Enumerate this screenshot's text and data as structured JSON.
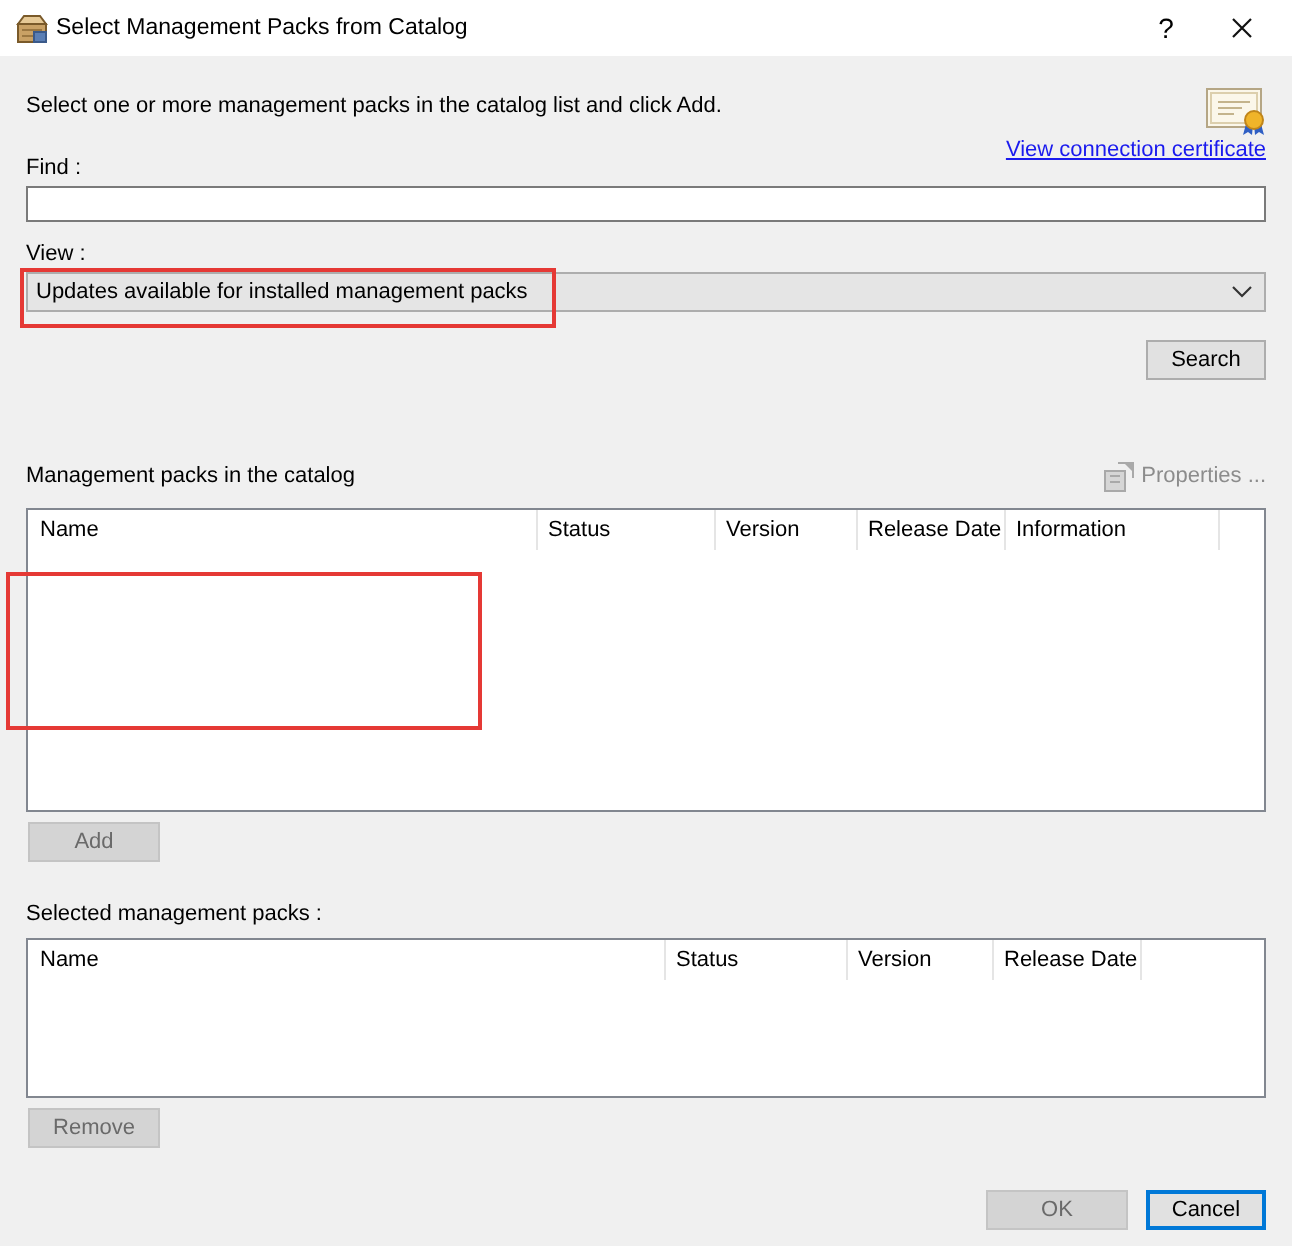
{
  "window": {
    "title": "Select Management Packs from Catalog",
    "help": "?"
  },
  "instructions": "Select one or more management packs in the catalog list and click Add.",
  "certificate_link": "View connection certificate",
  "find": {
    "label": "Find :"
  },
  "view": {
    "label": "View :",
    "value": "Updates available for installed management packs",
    "highlighted": true
  },
  "search_button": {
    "label": "Search",
    "disabled": false
  },
  "catalog": {
    "label": "Management packs in the catalog",
    "properties": {
      "label": "Properties ...",
      "disabled": true
    },
    "columns": [
      "Name",
      "Status",
      "Version",
      "Release Date",
      "Information"
    ],
    "highlighted": true
  },
  "add_button": {
    "label": "Add",
    "disabled": true
  },
  "selected_packs": {
    "label": "Selected management packs :",
    "columns": [
      "Name",
      "Status",
      "Version",
      "Release Date"
    ]
  },
  "remove_button": {
    "label": "Remove",
    "disabled": true
  },
  "buttons": [
    {
      "label": "OK",
      "disabled": true,
      "default": false
    },
    {
      "label": "Cancel",
      "disabled": false,
      "default": true
    }
  ]
}
